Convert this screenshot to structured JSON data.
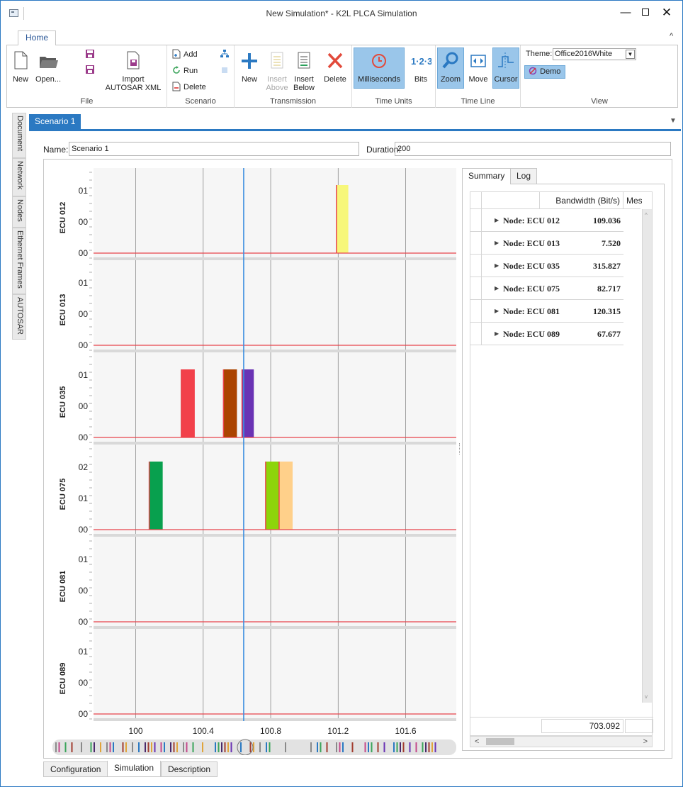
{
  "window": {
    "title": "New Simulation* - K2L PLCA Simulation"
  },
  "ribbon": {
    "tab": "Home",
    "groups": {
      "file": {
        "label": "File",
        "new": "New",
        "open": "Open...",
        "import": "Import AUTOSAR XML"
      },
      "scenario": {
        "label": "Scenario",
        "add": "Add",
        "run": "Run",
        "delete": "Delete"
      },
      "transmission": {
        "label": "Transmission",
        "new": "New",
        "insert_above": "Insert Above",
        "insert_below": "Insert Below",
        "delete": "Delete"
      },
      "time_units": {
        "label": "Time Units",
        "milliseconds": "Milliseconds",
        "bits": "Bits"
      },
      "time_line": {
        "label": "Time Line",
        "zoom": "Zoom",
        "move": "Move",
        "cursor": "Cursor"
      },
      "view": {
        "label": "View",
        "theme_label": "Theme:",
        "theme_value": "Office2016White",
        "demo": "Demo"
      }
    }
  },
  "side_tabs": [
    "Document",
    "Network",
    "Nodes",
    "Ethernet Frames",
    "AUTOSAR"
  ],
  "document": {
    "tab": "Scenario 1",
    "name_label": "Name:",
    "name_value": "Scenario 1",
    "duration_label": "Duration:",
    "duration_value": "200"
  },
  "summary": {
    "tabs": [
      "Summary",
      "Log"
    ],
    "columns": [
      "Bandwidth (Bit/s)",
      "Mes"
    ],
    "rows": [
      {
        "node": "Node: ECU 012",
        "bandwidth": "109.036"
      },
      {
        "node": "Node: ECU 013",
        "bandwidth": "7.520"
      },
      {
        "node": "Node: ECU 035",
        "bandwidth": "315.827"
      },
      {
        "node": "Node: ECU 075",
        "bandwidth": "82.717"
      },
      {
        "node": "Node: ECU 081",
        "bandwidth": "120.315"
      },
      {
        "node": "Node: ECU 089",
        "bandwidth": "67.677"
      }
    ],
    "total": "703.092"
  },
  "bottom_tabs": [
    "Configuration",
    "Simulation",
    "Description"
  ],
  "colors": {
    "accent": "#2b79c2",
    "cursor_line": "#3d8fe0",
    "signal_line": "#e8434b"
  },
  "chart_data": {
    "type": "timeline",
    "x_ticks": [
      100,
      100.4,
      100.8,
      101.2,
      101.6
    ],
    "x_range": [
      99.75,
      101.9
    ],
    "cursor_x": 100.64,
    "lanes": [
      {
        "name": "ECU 012",
        "levels": [
          "00",
          "00",
          "01"
        ],
        "blocks": [
          {
            "x0": 101.19,
            "x1": 101.26,
            "level": 2,
            "color": "#f7f77a"
          }
        ]
      },
      {
        "name": "ECU 013",
        "levels": [
          "00",
          "00",
          "01"
        ],
        "blocks": []
      },
      {
        "name": "ECU 035",
        "levels": [
          "00",
          "00",
          "01"
        ],
        "blocks": [
          {
            "x0": 100.27,
            "x1": 100.35,
            "level": 2,
            "color": "#f2404a"
          },
          {
            "x0": 100.52,
            "x1": 100.6,
            "level": 2,
            "color": "#ab4400"
          },
          {
            "x0": 100.63,
            "x1": 100.7,
            "level": 2,
            "color": "#6a33b4"
          }
        ]
      },
      {
        "name": "ECU 075",
        "levels": [
          "00",
          "01",
          "02"
        ],
        "blocks": [
          {
            "x0": 100.08,
            "x1": 100.16,
            "level": 2,
            "color": "#08a04e"
          },
          {
            "x0": 100.77,
            "x1": 100.85,
            "level": 2,
            "color": "#8dd40a"
          },
          {
            "x0": 100.85,
            "x1": 100.93,
            "level": 2,
            "color": "#ffd08a"
          }
        ]
      },
      {
        "name": "ECU 081",
        "levels": [
          "00",
          "00",
          "01"
        ],
        "blocks": []
      },
      {
        "name": "ECU 089",
        "levels": [
          "00",
          "00",
          "01"
        ],
        "blocks": []
      }
    ]
  }
}
